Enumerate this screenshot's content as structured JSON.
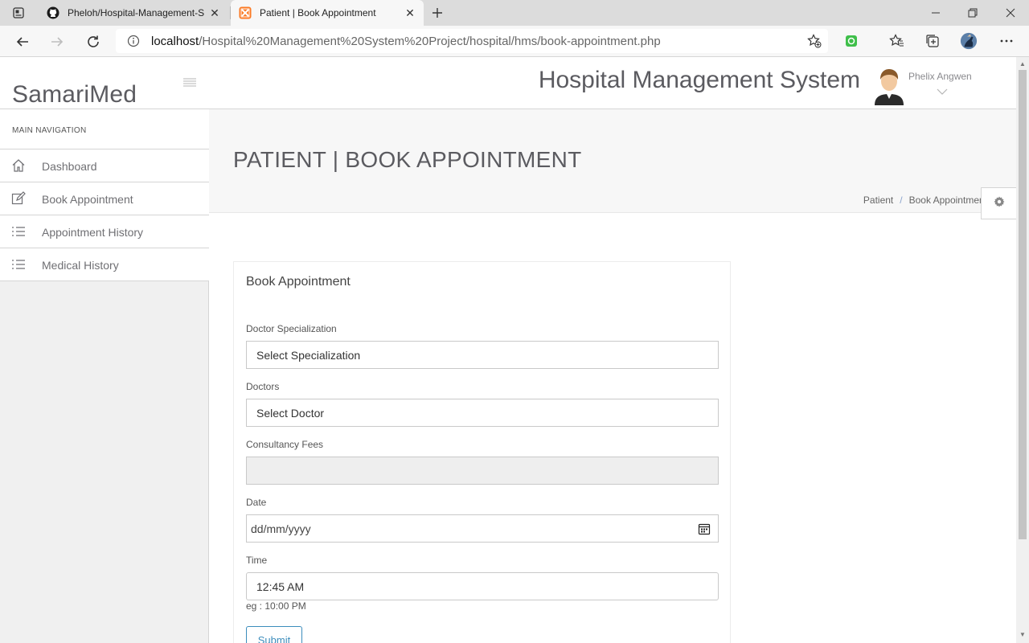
{
  "browser": {
    "tabs": [
      {
        "title": "Pheloh/Hospital-Management-S",
        "icon": "github-icon"
      },
      {
        "title": "Patient | Book Appointment",
        "icon": "xampp-icon"
      }
    ],
    "url_host": "localhost",
    "url_path": "/Hospital%20Management%20System%20Project/hospital/hms/book-appointment.php"
  },
  "sidebar": {
    "brand": "SamariMed",
    "nav_heading": "MAIN NAVIGATION",
    "items": [
      {
        "label": "Dashboard",
        "icon": "home-icon"
      },
      {
        "label": "Book Appointment",
        "icon": "edit-icon"
      },
      {
        "label": "Appointment History",
        "icon": "list-icon"
      },
      {
        "label": "Medical History",
        "icon": "list-icon"
      }
    ]
  },
  "header": {
    "title": "Hospital Management System",
    "user_name": "Phelix Angwen"
  },
  "page": {
    "title": "PATIENT | BOOK APPOINTMENT",
    "breadcrumb": [
      "Patient",
      "Book Appointment"
    ]
  },
  "form": {
    "title": "Book Appointment",
    "specialization_label": "Doctor Specialization",
    "specialization_value": "Select Specialization",
    "doctor_label": "Doctors",
    "doctor_value": "Select Doctor",
    "fees_label": "Consultancy Fees",
    "fees_value": "",
    "date_label": "Date",
    "date_placeholder": "dd/mm/yyyy",
    "time_label": "Time",
    "time_value": "12:45 AM",
    "time_hint": "eg : 10:00 PM",
    "submit_label": "Submit"
  },
  "colors": {
    "accent": "#3c8dbc",
    "sidebar_bg": "#f0f0f0",
    "title_band_bg": "#f7f7f7"
  }
}
